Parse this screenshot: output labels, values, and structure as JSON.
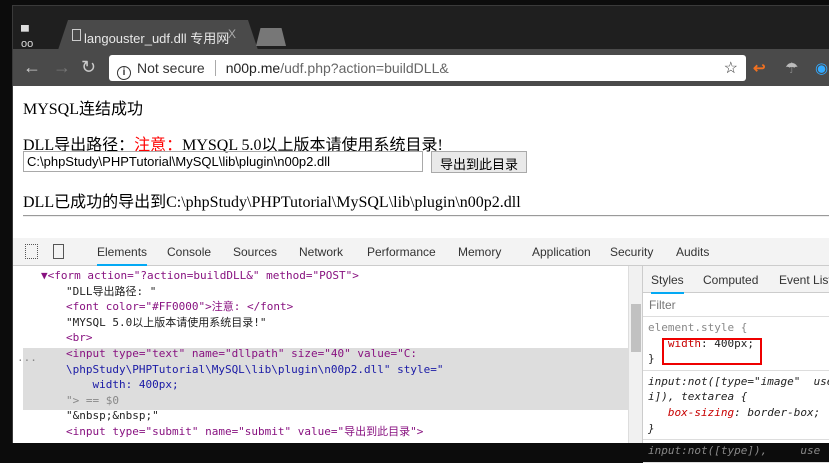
{
  "browser": {
    "tab_title": "langouster_udf.dll 专用网",
    "tab_close": "X",
    "not_secure": "Not secure",
    "url_host": "n00p.me",
    "url_path": "/udf.php?action=buildDLL&"
  },
  "page": {
    "line1": "MYSQL连结成功",
    "label": "DLL导出路径：",
    "warning": "注意：",
    "warning_rest": "MYSQL 5.0以上版本请使用系统目录!",
    "path_value": "C:\\phpStudy\\PHPTutorial\\MySQL\\lib\\plugin\\n00p2.dll",
    "submit": "导出到此目录",
    "result_prefix": "DLL已成功的导出到",
    "result_path": "C:\\phpStudy\\PHPTutorial\\MySQL\\lib\\plugin\\n00p2.dll"
  },
  "devtools": {
    "tabs": [
      "Elements",
      "Console",
      "Sources",
      "Network",
      "Performance",
      "Memory",
      "Application",
      "Security",
      "Audits"
    ],
    "lines": [
      "▼<form action=\"?action=buildDLL&\" method=\"POST\">",
      "\"DLL导出路径: \"",
      "<font color=\"#FF0000\">注意: </font>",
      "\"MYSQL 5.0以上版本请使用系统目录!\"",
      "<br>",
      "<input type=\"text\" name=\"dllpath\" size=\"40\" value=\"C:",
      "\\phpStudy\\PHPTutorial\\MySQL\\lib\\plugin\\n00p2.dll\" style=\"",
      "    width: 400px;",
      "\"> == $0",
      "\"&nbsp;&nbsp;\"",
      "<input type=\"submit\" name=\"submit\" value=\"导出到此目录\">"
    ],
    "dots": "...",
    "styles_tabs": [
      "Styles",
      "Computed",
      "Event List"
    ],
    "filter": "Filter",
    "rule1_sel": "element.style {",
    "rule1_prop": "width",
    "rule1_val": ": 400px;",
    "close": "}",
    "rule2_sel1": "input:not([type=\"image\"  use",
    "rule2_sel2": "i]), textarea {",
    "rule2_prop": "box-sizing",
    "rule2_val": ": border-box;",
    "rule3_sel": "input:not([type]),     use"
  }
}
